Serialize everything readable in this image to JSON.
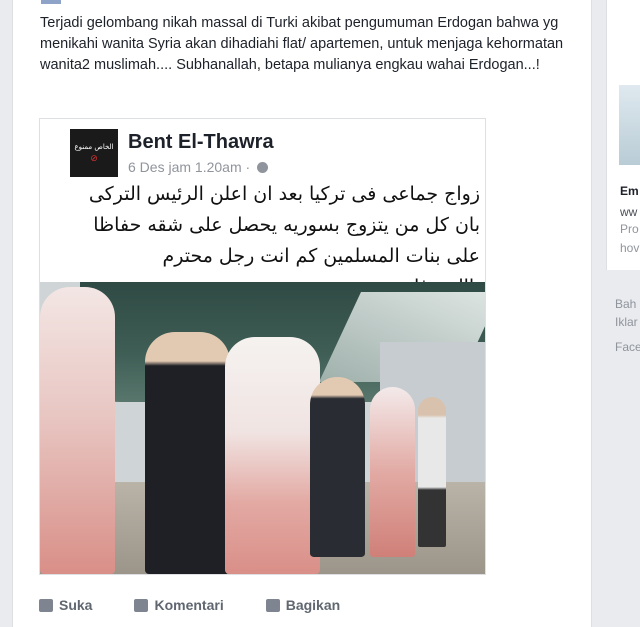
{
  "post": {
    "text": "Terjadi gelombang nikah massal di Turki akibat pengumuman Erdogan bahwa yg menikahi wanita Syria akan dihadiahi flat/ apartemen, untuk menjaga kehormatan wanita2 muslimah.... Subhanallah, betapa mulianya engkau wahai Erdogan...!"
  },
  "shared": {
    "name": "Bent El-Thawra",
    "meta": "6 Des jam 1.20am ·",
    "avatar_text": "الخاص ممنوع",
    "arabic_lines": [
      "زواج جماعى فى تركيا بعد ان اعلن الرئيس التركى",
      "بان كل من يتزوج بسوريه يحصل على شقه حفاظا",
      "على بنات المسلمين كم انت رجل محترم ياالردوغان"
    ]
  },
  "actions": {
    "like": "Suka",
    "comment": "Komentari",
    "share": "Bagikan"
  },
  "right_column": {
    "title": "Em",
    "url": "ww",
    "line1": "Pro",
    "line2": "hov",
    "foot1": "Bah",
    "foot2": "Iklar",
    "foot3": "Face"
  },
  "icons": {
    "globe": "globe-icon",
    "like": "thumbs-up-icon",
    "comment": "comment-icon",
    "share": "share-arrow-icon"
  }
}
